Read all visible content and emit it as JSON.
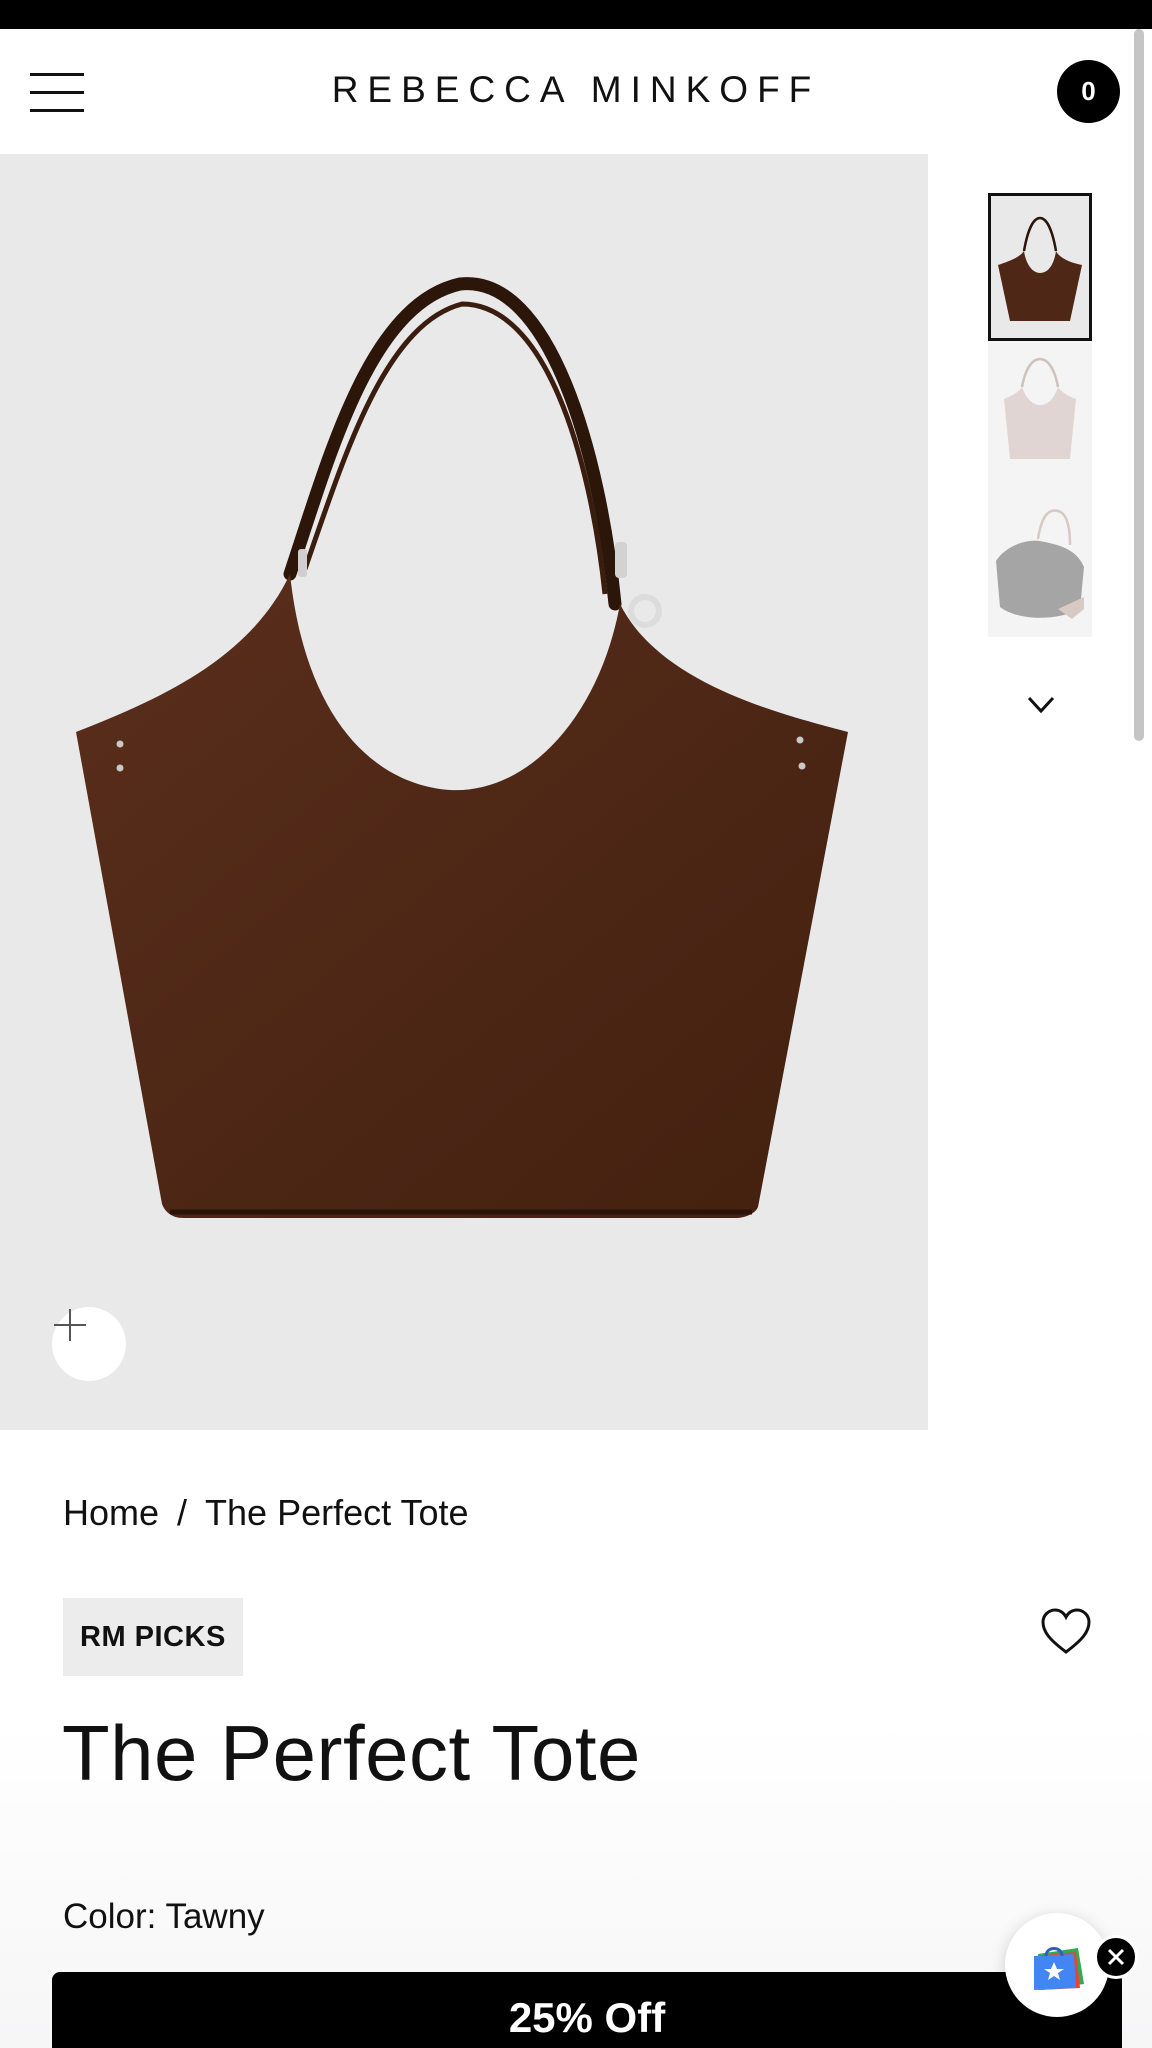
{
  "header": {
    "brand": "REBECCA MINKOFF",
    "cart_count": "0"
  },
  "gallery": {
    "thumbnails": [
      "thumbnail-1",
      "thumbnail-2",
      "thumbnail-3"
    ],
    "active_index": 0
  },
  "breadcrumb": {
    "home": "Home",
    "separator": "/",
    "current": "The Perfect Tote"
  },
  "product": {
    "badge": "RM PICKS",
    "title": "The Perfect Tote",
    "color_line": "Color: Tawny"
  },
  "promo": {
    "label": "25% Off"
  },
  "colors": {
    "bag": "#4e2716",
    "hero_bg": "#e9e9ea",
    "accent": "#000000"
  }
}
